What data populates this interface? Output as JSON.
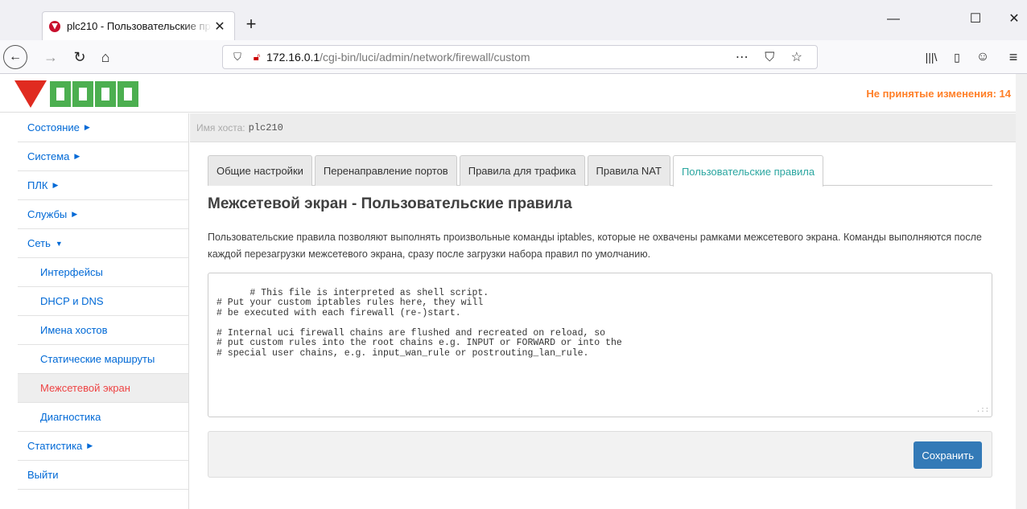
{
  "browser": {
    "tab_title": "plc210 - Пользовательские пр",
    "tab_close": "✕",
    "new_tab": "+",
    "url_host": "172.16.0.1",
    "url_path": "/cgi-bin/luci/admin/network/firewall/custom"
  },
  "header": {
    "changes": "Не принятые изменения: 14"
  },
  "sidebar": {
    "items": [
      {
        "label": "Состояние",
        "arrow": "▶"
      },
      {
        "label": "Система",
        "arrow": "▶"
      },
      {
        "label": "ПЛК",
        "arrow": "▶"
      },
      {
        "label": "Службы",
        "arrow": "▶"
      },
      {
        "label": "Сеть",
        "arrow": "▼"
      },
      {
        "label": "Интерфейсы"
      },
      {
        "label": "DHCP и DNS"
      },
      {
        "label": "Имена хостов"
      },
      {
        "label": "Статические маршруты"
      },
      {
        "label": "Межсетевой экран"
      },
      {
        "label": "Диагностика"
      },
      {
        "label": "Статистика",
        "arrow": "▶"
      },
      {
        "label": "Выйти"
      }
    ]
  },
  "host": {
    "label": "Имя хоста:",
    "value": "plc210"
  },
  "tabs": [
    "Общие настройки",
    "Перенаправление портов",
    "Правила для трафика",
    "Правила NAT",
    "Пользовательские правила"
  ],
  "main": {
    "title": "Межсетевой экран - Пользовательские правила",
    "description": "Пользовательские правила позволяют выполнять произвольные команды iptables, которые не охвачены рамками межсетевого экрана. Команды выполняются после каждой перезагрузки межсетевого экрана, сразу после загрузки набора правил по умолчанию.",
    "script": "# This file is interpreted as shell script.\n# Put your custom iptables rules here, they will\n# be executed with each firewall (re-)start.\n\n# Internal uci firewall chains are flushed and recreated on reload, so\n# put custom rules into the root chains e.g. INPUT or FORWARD or into the\n# special user chains, e.g. input_wan_rule or postrouting_lan_rule.",
    "save_label": "Сохранить"
  },
  "colors": {
    "accent": "#2aa6a0",
    "link": "#0069d6",
    "active_item": "#e44444",
    "changes": "#ff7f27",
    "button": "#337ab7"
  }
}
